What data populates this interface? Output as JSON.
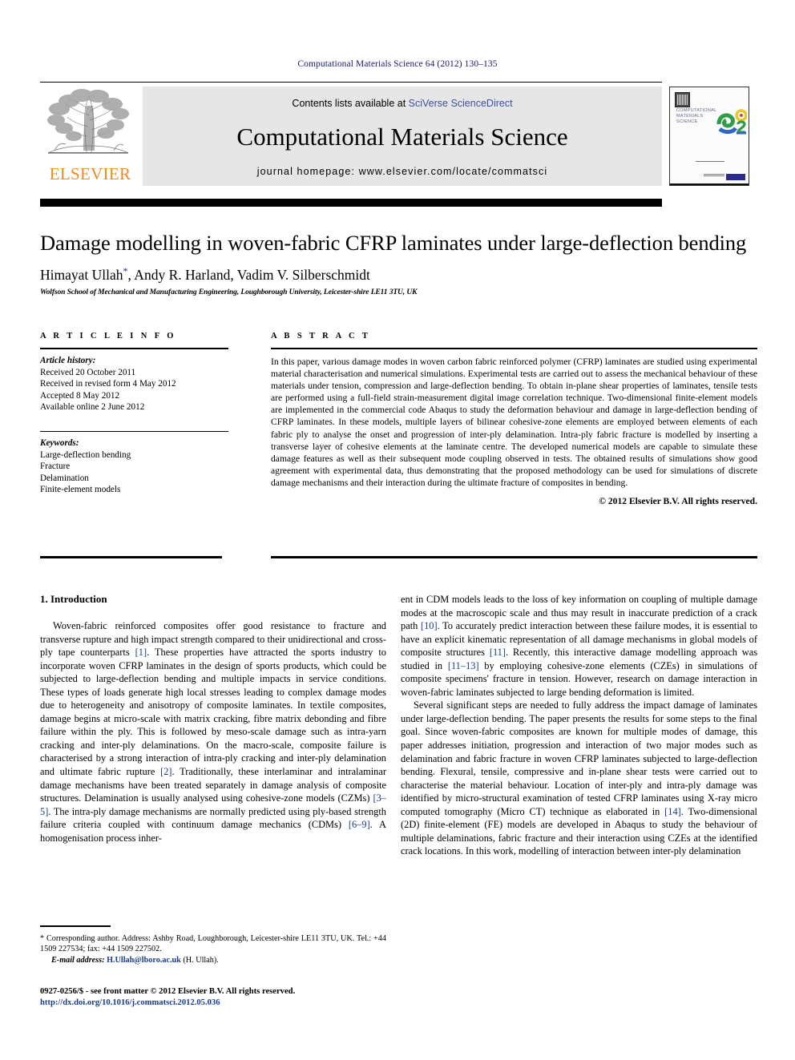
{
  "running_head": "Computational Materials Science 64 (2012) 130–135",
  "masthead": {
    "publisher_name": "ELSEVIER",
    "contents_prefix": "Contents lists available at ",
    "contents_link": "SciVerse ScienceDirect",
    "journal_title": "Computational Materials Science",
    "homepage": "journal homepage: www.elsevier.com/locate/commatsci",
    "cover": {
      "line1": "COMPUTATIONAL",
      "line2": "MATERIALS",
      "line3": "SCIENCE"
    }
  },
  "article": {
    "title": "Damage modelling in woven-fabric CFRP laminates under large-deflection bending",
    "authors": "Himayat Ullah",
    "authors_rest": ", Andy R. Harland, Vadim V. Silberschmidt",
    "corresponding_marker": "*",
    "affiliation": "Wolfson School of Mechanical and Manufacturing Engineering, Loughborough University, Leicester-shire LE11 3TU, UK"
  },
  "article_info": {
    "heading": "A R T I C L E  I N F O",
    "history_label": "Article history:",
    "history": [
      "Received 20 October 2011",
      "Received in revised form 4 May 2012",
      "Accepted 8 May 2012",
      "Available online 2 June 2012"
    ],
    "keywords_label": "Keywords:",
    "keywords": [
      "Large-deflection bending",
      "Fracture",
      "Delamination",
      "Finite-element models"
    ]
  },
  "abstract": {
    "heading": "A B S T R A C T",
    "text": "In this paper, various damage modes in woven carbon fabric reinforced polymer (CFRP) laminates are studied using experimental material characterisation and numerical simulations. Experimental tests are carried out to assess the mechanical behaviour of these materials under tension, compression and large-deflection bending. To obtain in-plane shear properties of laminates, tensile tests are performed using a full-field strain-measurement digital image correlation technique. Two-dimensional finite-element models are implemented in the commercial code Abaqus to study the deformation behaviour and damage in large-deflection bending of CFRP laminates. In these models, multiple layers of bilinear cohesive-zone elements are employed between elements of each fabric ply to analyse the onset and progression of inter-ply delamination. Intra-ply fabric fracture is modelled by inserting a transverse layer of cohesive elements at the laminate centre. The developed numerical models are capable to simulate these damage features as well as their subsequent mode coupling observed in tests. The obtained results of simulations show good agreement with experimental data, thus demonstrating that the proposed methodology can be used for simulations of discrete damage mechanisms and their interaction during the ultimate fracture of composites in bending.",
    "copyright": "© 2012 Elsevier B.V. All rights reserved."
  },
  "body": {
    "section_heading": "1. Introduction",
    "left_p1_a": "Woven-fabric reinforced composites offer good resistance to fracture and transverse rupture and high impact strength compared to their unidirectional and cross-ply tape counterparts ",
    "left_p1_r1": "[1]",
    "left_p1_b": ". These properties have attracted the sports industry to incorporate woven CFRP laminates in the design of sports products, which could be subjected to large-deflection bending and multiple impacts in service conditions. These types of loads generate high local stresses leading to complex damage modes due to heterogeneity and anisotropy of composite laminates. In textile composites, damage begins at micro-scale with matrix cracking, fibre matrix debonding and fibre failure within the ply. This is followed by meso-scale damage such as intra-yarn cracking and inter-ply delaminations. On the macro-scale, composite failure is characterised by a strong interaction of intra-ply cracking and inter-ply delamination and ultimate fabric rupture ",
    "left_p1_r2": "[2]",
    "left_p1_c": ". Traditionally, these interlaminar and intralaminar damage mechanisms have been treated separately in damage analysis of composite structures. Delamination is usually analysed using cohesive-zone models (CZMs) ",
    "left_p1_r3": "[3–5]",
    "left_p1_d": ". The intra-ply damage mechanisms are normally predicted using ply-based strength failure criteria coupled with continuum damage mechanics (CDMs) ",
    "left_p1_r4": "[6–9]",
    "left_p1_e": ". A homogenisation process inher-",
    "right_p1_a": "ent in CDM models leads to the loss of key information on coupling of multiple damage modes at the macroscopic scale and thus may result in inaccurate prediction of a crack path ",
    "right_p1_r1": "[10]",
    "right_p1_b": ". To accurately predict interaction between these failure modes, it is essential to have an explicit kinematic representation of all damage mechanisms in global models of composite structures ",
    "right_p1_r2": "[11]",
    "right_p1_c": ". Recently, this interactive damage modelling approach was studied in ",
    "right_p1_r3": "[11–13]",
    "right_p1_d": " by employing cohesive-zone elements (CZEs) in simulations of composite specimens' fracture in tension. However, research on damage interaction in woven-fabric laminates subjected to large bending deformation is limited.",
    "right_p2_a": "Several significant steps are needed to fully address the impact damage of laminates under large-deflection bending. The paper presents the results for some steps to the final goal. Since woven-fabric composites are known for multiple modes of damage, this paper addresses initiation, progression and interaction of two major modes such as delamination and fabric fracture in woven CFRP laminates subjected to large-deflection bending. Flexural, tensile, compressive and in-plane shear tests were carried out to characterise the material behaviour. Location of inter-ply and intra-ply damage was identified by micro-structural examination of tested CFRP laminates using X-ray micro computed tomography (Micro CT) technique as elaborated in ",
    "right_p2_r1": "[14]",
    "right_p2_b": ". Two-dimensional (2D) finite-element (FE) models are developed in Abaqus to study the behaviour of multiple delaminations, fabric fracture and their interaction using CZEs at the identified crack locations. In this work, modelling of interaction between inter-ply delamination"
  },
  "footnote": {
    "line1": "* Corresponding author. Address: Ashby Road, Loughborough, Leicester-shire LE11 3TU, UK. Tel.: +44 1509 227534; fax: +44 1509 227502.",
    "email_label": "E-mail address:",
    "email": "H.Ullah@lboro.ac.uk",
    "email_suffix": " (H. Ullah)."
  },
  "page_footer": {
    "issn_line": "0927-0256/$ - see front matter © 2012 Elsevier B.V. All rights reserved.",
    "doi_line": "http://dx.doi.org/10.1016/j.commatsci.2012.05.036"
  },
  "colors": {
    "link_blue": "#3a52a6",
    "ref_blue": "#1a3c8c",
    "elsevier_orange": "#f08a1c",
    "running_head": "#1a1a6e"
  }
}
